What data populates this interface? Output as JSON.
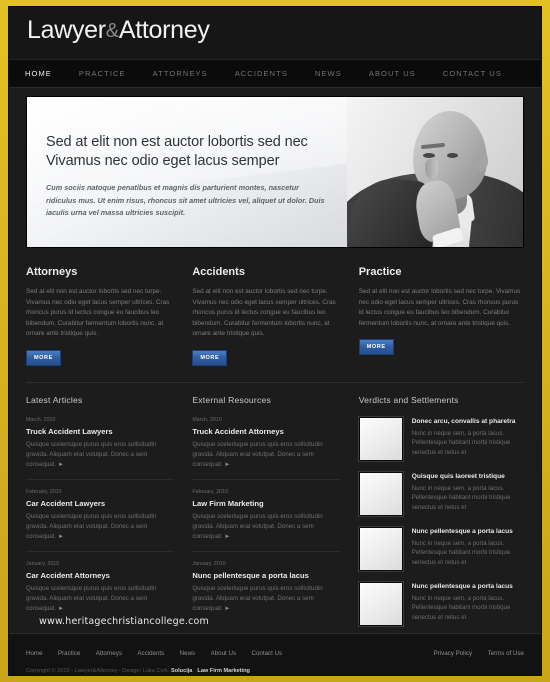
{
  "site": {
    "logo_main": "Lawyer",
    "logo_amp": "&",
    "logo_second": "Attorney"
  },
  "nav": {
    "items": [
      {
        "label": "HOME",
        "active": true
      },
      {
        "label": "PRACTICE",
        "active": false
      },
      {
        "label": "ATTORNEYS",
        "active": false
      },
      {
        "label": "ACCIDENTS",
        "active": false
      },
      {
        "label": "NEWS",
        "active": false
      },
      {
        "label": "ABOUT US",
        "active": false
      },
      {
        "label": "CONTACT US",
        "active": false
      }
    ]
  },
  "hero": {
    "title_line1": "Sed at elit non est auctor lobortis sed nec",
    "title_line2": "Vivamus nec odio eget lacus semper",
    "subtitle": "Cum sociis natoque penatibus et magnis dis parturient montes, nascetur ridiculus mus. Ut enim risus, rhoncus sit amet ultricies vel, aliquet ut dolor. Duis iaculis urna vel massa ultricies suscipit.",
    "image_alt": "portrait-of-man-in-suit"
  },
  "services": [
    {
      "title": "Attorneys",
      "body": "Sed at elit non est auctor lobortis sed nec turpe. Vivamus nec odio eget lacus semper ultrices. Cras rhoncus purus id lectus congue eu faucibus leo bibendum. Curabitur fermentum lobortis nunc, at ornare ante tristique quis.",
      "button": "MORE"
    },
    {
      "title": "Accidents",
      "body": "Sed at elit non est auctor lobortis sed nec turpe. Vivamus nec odio eget lacus semper ultrices. Cras rhoncus purus id lectus congue eu faucibus leo bibendum. Curabitur fermentum lobortis nunc, at ornare ante tristique quis.",
      "button": "MORE"
    },
    {
      "title": "Practice",
      "body": "Sed at elit non est auctor lobortis sed nec turpe. Vivamus nec odio eget lacus semper ultrices. Cras rhoncus purus id lectus congue eu faucibus leo bibendum. Curabitur fermentum lobortis nunc, at ornare ante tristique quis.",
      "button": "MORE"
    }
  ],
  "latest_articles": {
    "heading": "Latest Articles",
    "items": [
      {
        "date": "March, 2010",
        "title": "Truck Accident Lawyers",
        "excerpt": "Quisque scelerisque purus quis eros sollicitudin gravida. Aliquam erat volutpat. Donec a sem consequat."
      },
      {
        "date": "February, 2010",
        "title": "Car Accident Lawyers",
        "excerpt": "Quisque scelerisque purus quis eros sollicitudin gravida. Aliquam erat volutpat. Donec a sem consequat."
      },
      {
        "date": "January, 2010",
        "title": "Car Accident Attorneys",
        "excerpt": "Quisque scelerisque purus quis eros sollicitudin gravida. Aliquam erat volutpat. Donec a sem consequat."
      }
    ]
  },
  "external_resources": {
    "heading": "External Resources",
    "items": [
      {
        "date": "March, 2010",
        "title": "Truck Accident Attorneys",
        "excerpt": "Quisque scelerisque purus quis eros sollicitudin gravida. Aliquam erat volutpat. Donec a sem consequat."
      },
      {
        "date": "February, 2010",
        "title": "Law Firm Marketing",
        "excerpt": "Quisque scelerisque purus quis eros sollicitudin gravida. Aliquam erat volutpat. Donec a sem consequat."
      },
      {
        "date": "January, 2010",
        "title": "Nunc pellentesque a porta lacus",
        "excerpt": "Quisque scelerisque purus quis eros sollicitudin gravida. Aliquam erat volutpat. Donec a sem consequat."
      }
    ]
  },
  "verdicts": {
    "heading": "Verdicts and Settlements",
    "items": [
      {
        "title": "Donec arcu, convallis at pharetra",
        "desc": "Nunc in neque sem, a porta lacus. Pellentesque habitant morbi tristique senectus et netus et"
      },
      {
        "title": "Quisque quis laoreet tristique",
        "desc": "Nunc in neque sem, a porta lacus. Pellentesque habitant morbi tristique senectus et netus et"
      },
      {
        "title": "Nunc pellentesque a porta lacus",
        "desc": "Nunc in neque sem, a porta lacus. Pellentesque habitant morbi tristique senectus et netus et"
      },
      {
        "title": "Nunc pellentesque a porta lacus",
        "desc": "Nunc in neque sem, a porta lacus. Pellentesque habitant morbi tristique senectus et netus et"
      }
    ]
  },
  "watermark": "www.heritagechristiancollege.com",
  "footer": {
    "nav": [
      "Home",
      "Practice",
      "Attorneys",
      "Accidents",
      "News",
      "About Us",
      "Contact Us"
    ],
    "right": [
      "Privacy Policy",
      "Terms of Use"
    ],
    "copyright_pre": "Copyright © 2010 - Lawyer&Attorney - Design: Luka Cvrk, ",
    "copyright_bold": "Solucija",
    "copyright_mid": "  -  ",
    "copyright_link": "Law Firm Marketing"
  },
  "colors": {
    "frame": "#d4af1e",
    "page_bg": "#1c1c1c",
    "accent_button": "#2f5d9e",
    "heading": "#ececec",
    "body_text": "#7c7c7c"
  }
}
